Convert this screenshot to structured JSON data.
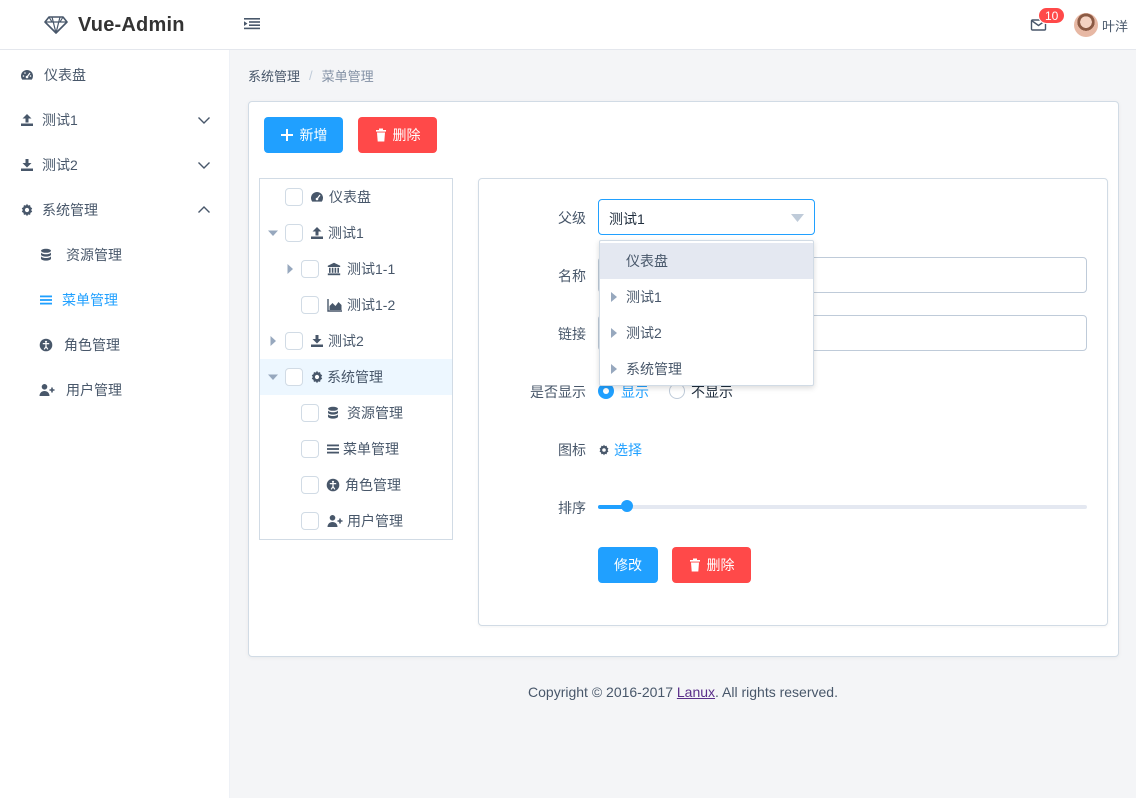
{
  "header": {
    "brand": "Vue-Admin",
    "mail_count": "10",
    "username": "叶洋"
  },
  "sidebar": {
    "items": [
      {
        "label": "仪表盘",
        "icon": "dashboard-icon"
      },
      {
        "label": "测试1",
        "icon": "upload-icon",
        "expanded": false
      },
      {
        "label": "测试2",
        "icon": "download-icon",
        "expanded": false
      },
      {
        "label": "系统管理",
        "icon": "gear-icon",
        "expanded": true
      },
      {
        "label": "资源管理",
        "icon": "database-icon"
      },
      {
        "label": "菜单管理",
        "icon": "bars-icon",
        "active": true
      },
      {
        "label": "角色管理",
        "icon": "accessibility-icon"
      },
      {
        "label": "用户管理",
        "icon": "user-plus-icon"
      }
    ]
  },
  "breadcrumb": [
    "系统管理",
    "菜单管理"
  ],
  "toolbar": {
    "add_label": "新增",
    "delete_label": "删除"
  },
  "tree": {
    "nodes": [
      {
        "label": "仪表盘",
        "icon": "dashboard-icon",
        "level": 0,
        "expandable": false
      },
      {
        "label": "测试1",
        "icon": "upload-icon",
        "level": 0,
        "expandable": true,
        "expanded": true
      },
      {
        "label": "测试1-1",
        "icon": "bank-icon",
        "level": 1,
        "expandable": true,
        "expanded": false
      },
      {
        "label": "测试1-2",
        "icon": "area-chart-icon",
        "level": 1,
        "expandable": false
      },
      {
        "label": "测试2",
        "icon": "download-icon",
        "level": 0,
        "expandable": true,
        "expanded": false
      },
      {
        "label": "系统管理",
        "icon": "gear-icon",
        "level": 0,
        "expandable": true,
        "expanded": true,
        "highlighted": true
      },
      {
        "label": "资源管理",
        "icon": "database-icon",
        "level": 1,
        "expandable": false
      },
      {
        "label": "菜单管理",
        "icon": "bars-icon",
        "level": 1,
        "expandable": false
      },
      {
        "label": "角色管理",
        "icon": "accessibility-icon",
        "level": 1,
        "expandable": false
      },
      {
        "label": "用户管理",
        "icon": "user-plus-icon",
        "level": 1,
        "expandable": false
      }
    ]
  },
  "form": {
    "parent_label": "父级",
    "parent_value": "测试1",
    "name_label": "名称",
    "name_value": "",
    "link_label": "链接",
    "link_value": "",
    "visible_label": "是否显示",
    "visible_options": [
      "显示",
      "不显示"
    ],
    "visible_selected": 0,
    "icon_label": "图标",
    "icon_choose": "选择",
    "order_label": "排序",
    "order_value": 6,
    "order_max": 100,
    "update_label": "修改",
    "delete_label": "删除"
  },
  "dropdown": {
    "options": [
      {
        "label": "仪表盘",
        "has_children": false,
        "hover": true
      },
      {
        "label": "测试1",
        "has_children": true
      },
      {
        "label": "测试2",
        "has_children": true
      },
      {
        "label": "系统管理",
        "has_children": true
      }
    ]
  },
  "footer": {
    "prefix": "Copyright © 2016-2017 ",
    "link": "Lanux",
    "suffix": ". All rights reserved."
  },
  "colors": {
    "primary": "#20a0ff",
    "danger": "#ff4949",
    "text": "#48576a",
    "border": "#d1dbe5",
    "background": "#f4f5f7"
  }
}
